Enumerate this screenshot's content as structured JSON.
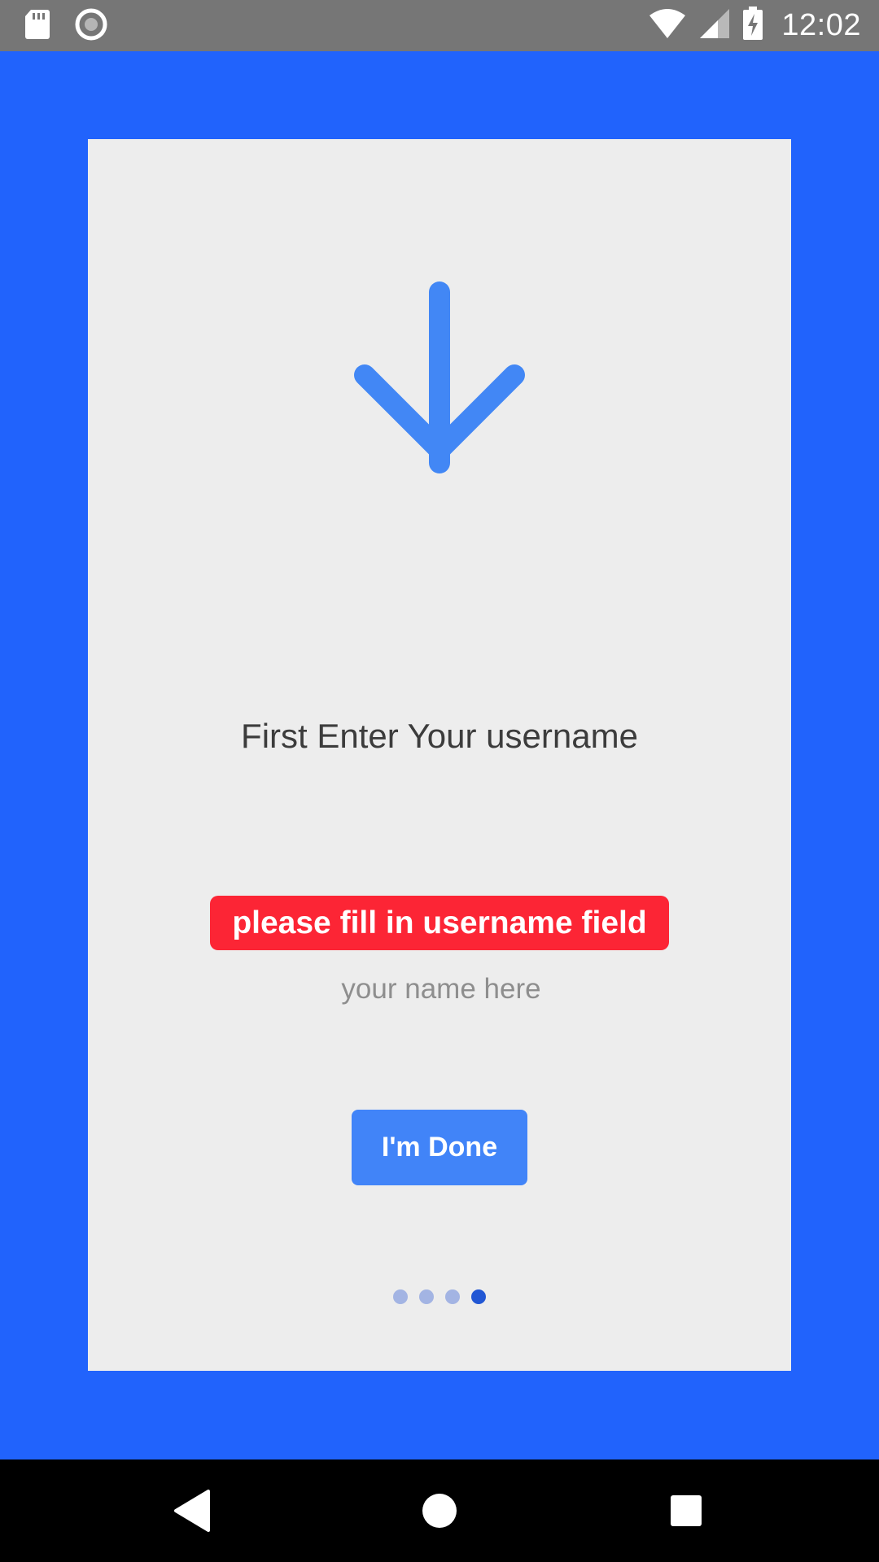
{
  "status_bar": {
    "time": "12:02",
    "icons": [
      "sd-card-icon",
      "sync-icon",
      "wifi-icon",
      "cell-signal-icon",
      "battery-charging-icon"
    ]
  },
  "colors": {
    "background": "#2163fc",
    "card": "#ededed",
    "accent": "#4184f8",
    "error": "#fc2535",
    "dot_inactive": "#a3b4e3",
    "dot_active": "#2257d4"
  },
  "onboarding": {
    "icon": "arrow-down-icon",
    "title": "First Enter Your username",
    "error_message": "please fill in username field",
    "username_input": {
      "value": "",
      "placeholder": "your name here"
    },
    "done_button_label": "I'm Done",
    "page_indicator": {
      "total": 4,
      "current": 4
    }
  },
  "nav_bar": {
    "buttons": [
      "back-icon",
      "home-icon",
      "recents-icon"
    ]
  }
}
